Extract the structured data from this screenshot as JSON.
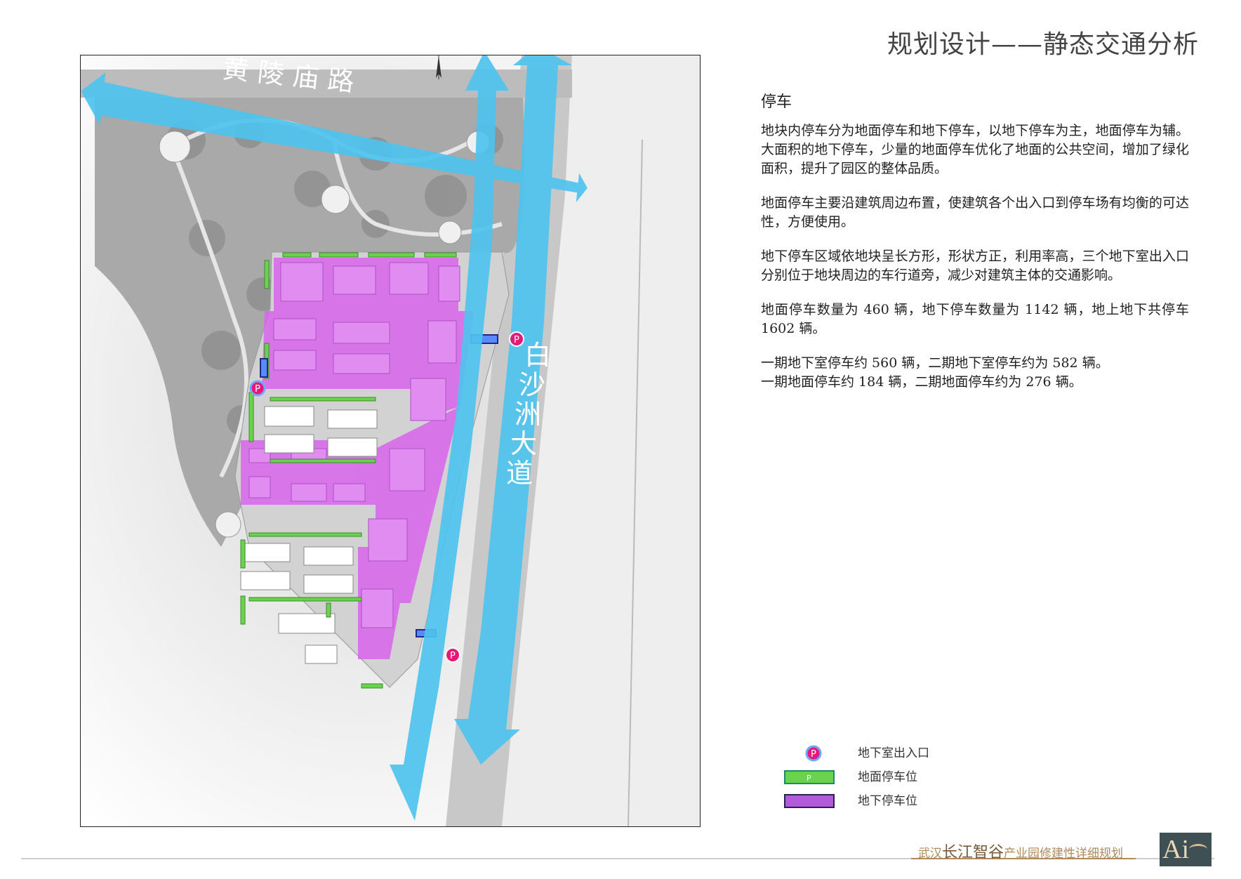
{
  "page_title": "规划设计——静态交通分析",
  "map": {
    "road_north_label": "黄 陵 庙 路",
    "road_east_label": [
      "白",
      "沙",
      "洲",
      "大",
      "道"
    ],
    "parking_symbol": "P"
  },
  "text_panel": {
    "heading": "停车",
    "paragraphs": [
      "地块内停车分为地面停车和地下停车，以地下停车为主，地面停车为辅。大面积的地下停车，少量的地面停车优化了地面的公共空间，增加了绿化面积，提升了园区的整体品质。",
      "地面停车主要沿建筑周边布置，使建筑各个出入口到停车场有均衡的可达性，方便使用。",
      "地下停车区域依地块呈长方形，形状方正，利用率高，三个地下室出入口分别位于地块周边的车行道旁，减少对建筑主体的交通影响。",
      "地面停车数量为 460 辆，地下停车数量为 1142 辆，地上地下共停车 1602 辆。"
    ],
    "phase_lines": [
      "一期地下室停车约 560 辆，二期地下室停车约为 582 辆。",
      "一期地面停车约 184 辆，二期地面停车约为 276 辆。"
    ]
  },
  "legend": {
    "items": [
      {
        "label": "地下室出入口",
        "symbol": "P"
      },
      {
        "label": "地面停车位",
        "symbol": "P"
      },
      {
        "label": "地下停车位",
        "symbol": ""
      }
    ]
  },
  "footer": {
    "prefix": "武汉",
    "emphasis": "长江智谷",
    "suffix": "产业园修建性详细规划",
    "logo_text": "Ai"
  },
  "colors": {
    "arrow": "#4fc3ee",
    "underground": "#d869ec",
    "surface_parking": "#6ad24e",
    "entrance": "#e6197a"
  }
}
